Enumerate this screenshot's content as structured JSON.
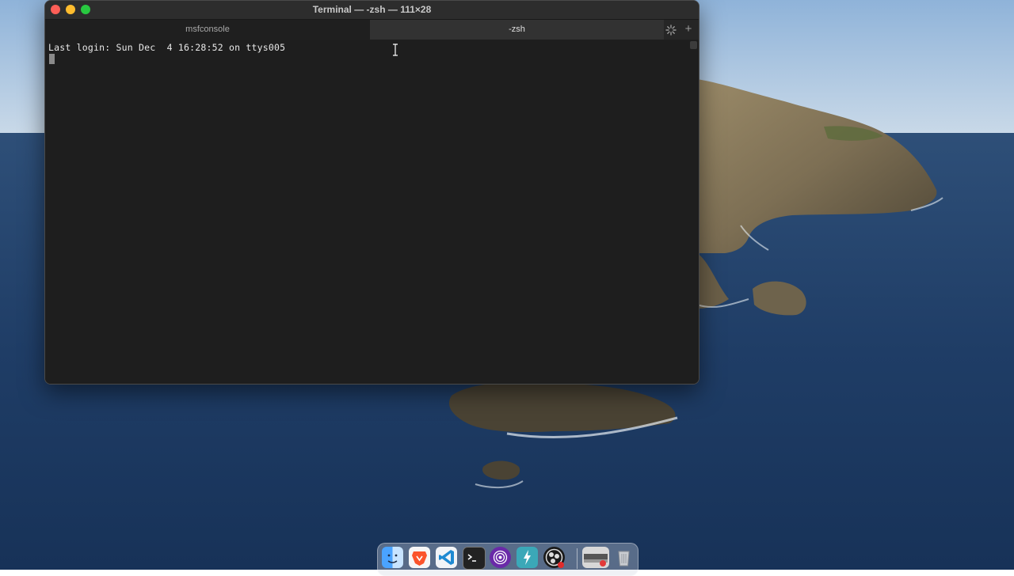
{
  "window": {
    "title": "Terminal — -zsh — 111×28"
  },
  "tabs": [
    {
      "label": "msfconsole",
      "active": false
    },
    {
      "label": "-zsh",
      "active": true
    }
  ],
  "terminal": {
    "lines": [
      "Last login: Sun Dec  4 16:28:52 on ttys005"
    ]
  },
  "dock": {
    "items": [
      {
        "name": "finder-icon"
      },
      {
        "name": "brave-browser-icon"
      },
      {
        "name": "vscode-icon"
      },
      {
        "name": "terminal-icon"
      },
      {
        "name": "tor-browser-icon"
      },
      {
        "name": "electron-app-icon"
      },
      {
        "name": "obs-icon"
      },
      {
        "name": "screenshot-thumbnail-icon"
      },
      {
        "name": "trash-icon"
      }
    ]
  },
  "colors": {
    "terminal_bg": "#1e1e1e",
    "terminal_fg": "#e8e8e8",
    "close": "#ff5f57",
    "minimize": "#febc2e",
    "maximize": "#28c840"
  }
}
